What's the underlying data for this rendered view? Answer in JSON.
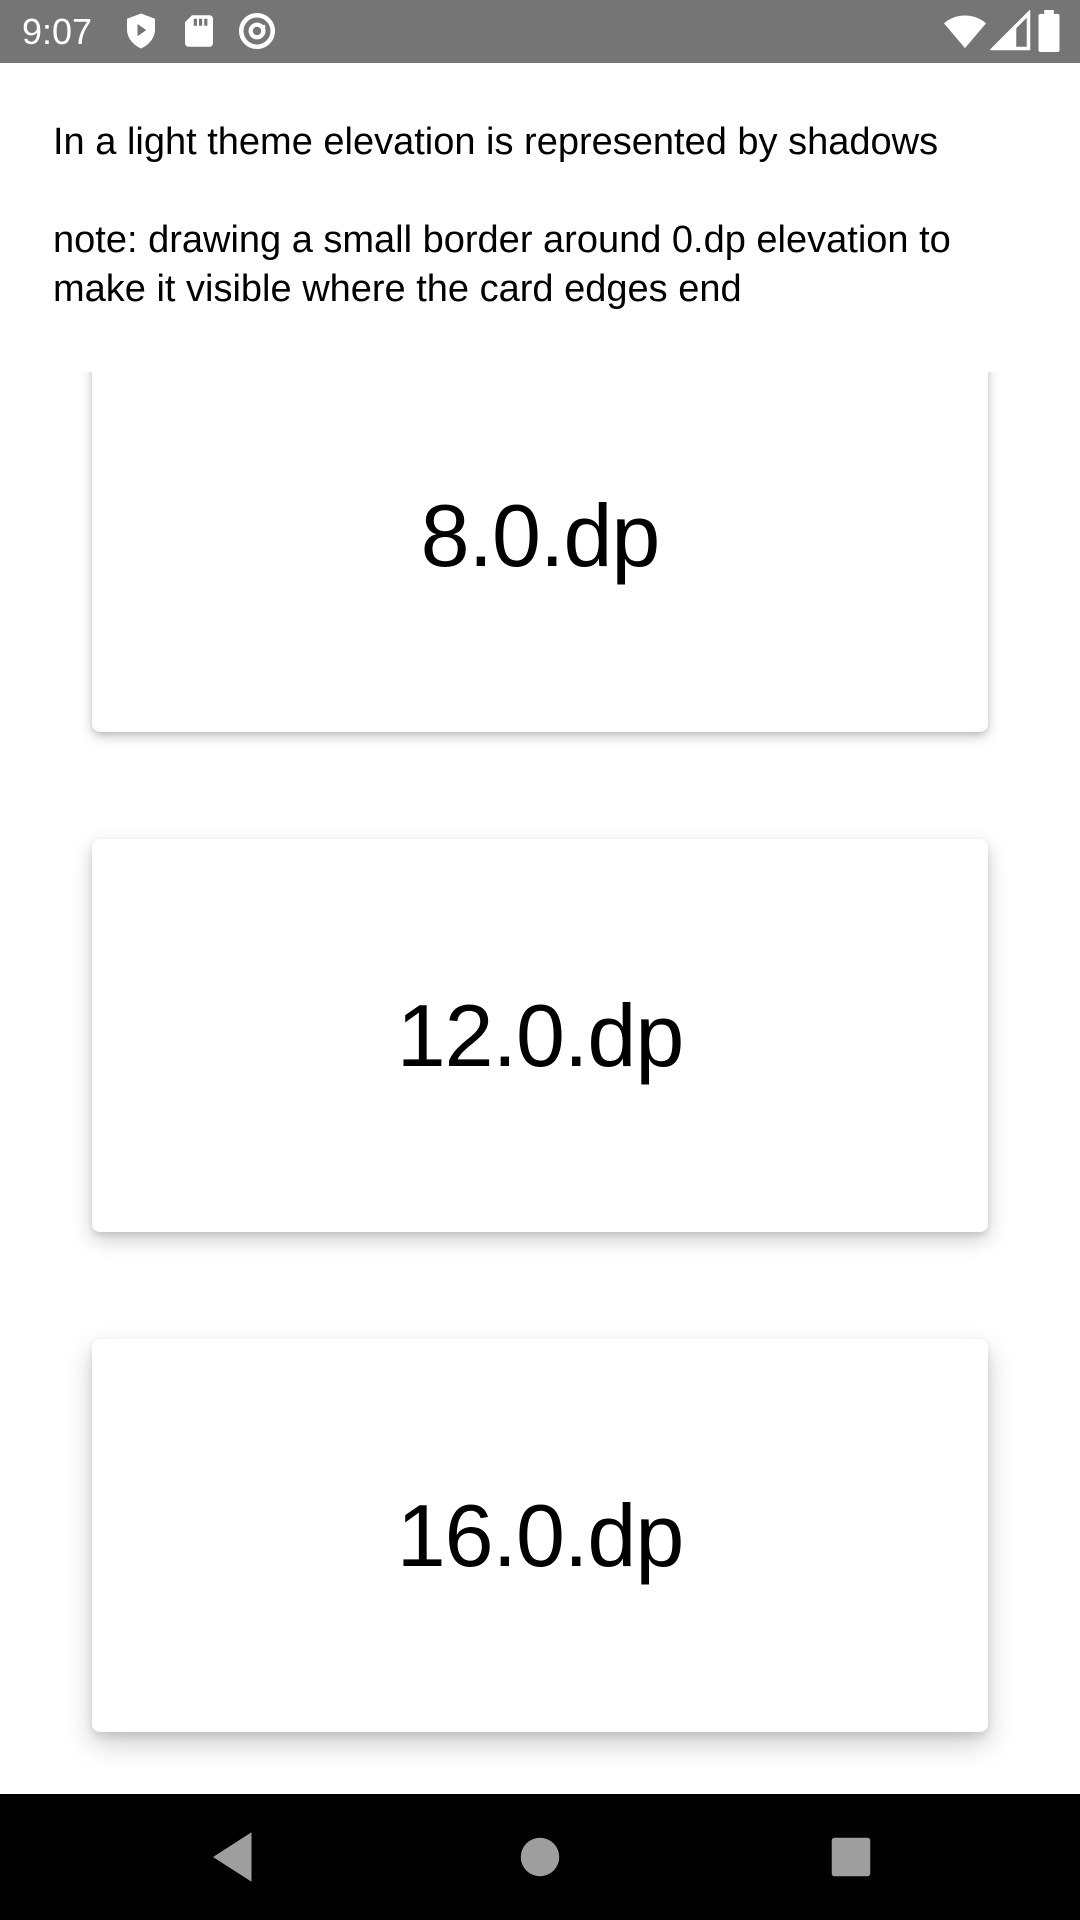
{
  "status_bar": {
    "time": "9:07",
    "left_icons": [
      "shield-play-icon",
      "sd-card-icon",
      "at-sign-icon"
    ],
    "right_icons": [
      "wifi-icon",
      "cell-signal-icon",
      "battery-icon"
    ]
  },
  "header": {
    "intro": "In a light theme elevation is represented by shadows",
    "note": "note: drawing a small border around 0.dp elevation to make it visible where the card edges end"
  },
  "cards": [
    {
      "label": "8.0.dp",
      "elevation_dp": 8
    },
    {
      "label": "12.0.dp",
      "elevation_dp": 12
    },
    {
      "label": "16.0.dp",
      "elevation_dp": 16
    }
  ],
  "nav_bar": {
    "buttons": [
      "back-icon",
      "home-icon",
      "recents-icon"
    ]
  },
  "colors": {
    "status_bar": "#757575",
    "nav_bar": "#000000",
    "background": "#ffffff",
    "card": "#ffffff",
    "text": "#000000"
  }
}
